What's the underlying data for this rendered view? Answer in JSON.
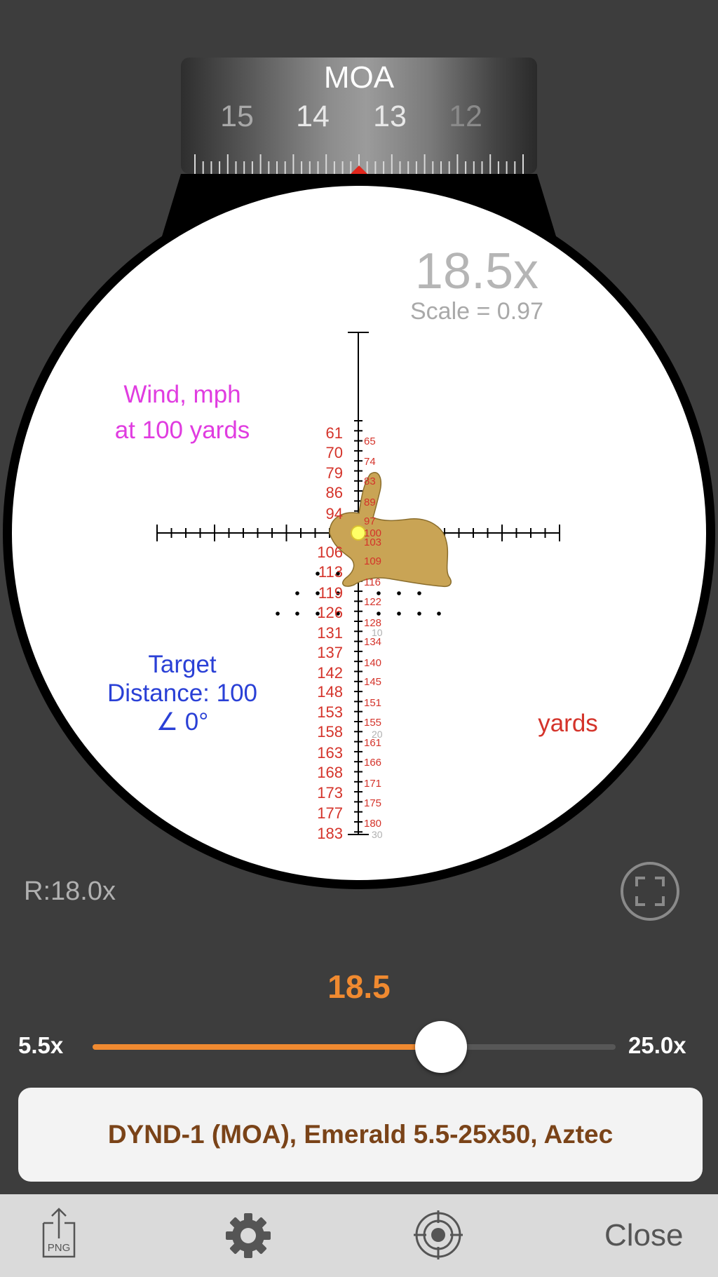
{
  "dial": {
    "title": "MOA",
    "numbers": [
      "15",
      "14",
      "13",
      "12"
    ]
  },
  "scope": {
    "magnification": "18.5x",
    "scale": "Scale = 0.97",
    "wind_line1": "Wind, mph",
    "wind_line2": "at 100 yards",
    "target_line1": "Target",
    "target_line2": "Distance: 100",
    "target_line3": "∠ 0°",
    "range_unit": "yards",
    "range_left": [
      "61",
      "70",
      "79",
      "86",
      "94",
      "106",
      "113",
      "119",
      "126",
      "131",
      "137",
      "142",
      "148",
      "153",
      "158",
      "163",
      "168",
      "173",
      "177",
      "183"
    ],
    "range_right": [
      "65",
      "74",
      "83",
      "89",
      "97",
      "100",
      "103",
      "109",
      "116",
      "122",
      "128",
      "134",
      "140",
      "145",
      "151",
      "155",
      "161",
      "166",
      "171",
      "175",
      "180"
    ],
    "grey_ticks": [
      "10",
      "20",
      "30"
    ]
  },
  "zoom_readout": "R:18.0x",
  "slider": {
    "value": "18.5",
    "min_label": "5.5x",
    "max_label": "25.0x",
    "min": 5.5,
    "max": 25.0,
    "current": 18.5
  },
  "info_bar": "DYND-1 (MOA), Emerald 5.5-25x50, Aztec",
  "toolbar": {
    "export_label": "PNG",
    "close_label": "Close"
  },
  "colors": {
    "accent": "#f08a30",
    "range": "#d4332a",
    "wind": "#e03ce0",
    "target": "#2a40d6",
    "rabbit": "#c9a455"
  }
}
